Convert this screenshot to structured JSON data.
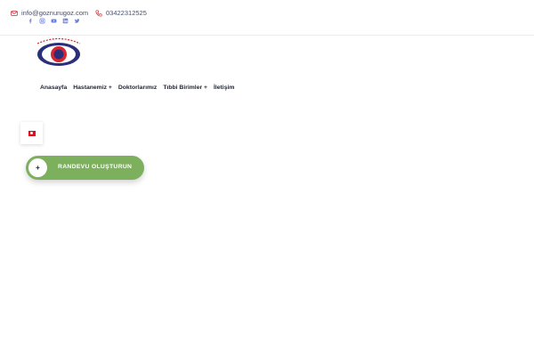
{
  "header": {
    "email": "info@goznurugoz.com",
    "phone": "03422312525",
    "socials": [
      "facebook-icon",
      "instagram-icon",
      "youtube-icon",
      "linkedin-icon",
      "twitter-icon"
    ]
  },
  "nav": {
    "items": [
      {
        "label": "Anasayfa"
      },
      {
        "label": "Hastanemiz +"
      },
      {
        "label": "Doktorlarımız"
      },
      {
        "label": "Tıbbi Birimler +"
      },
      {
        "label": "İletişim"
      }
    ]
  },
  "language": {
    "flag": "turkey-flag-icon"
  },
  "cta": {
    "plus": "+",
    "label": "RANDEVU OLUŞTURUN"
  },
  "colors": {
    "accent_green": "#7cb05d",
    "icon_blue": "#6b7fd6",
    "brand_red": "#d7262e",
    "brand_navy": "#2b2f7a"
  }
}
